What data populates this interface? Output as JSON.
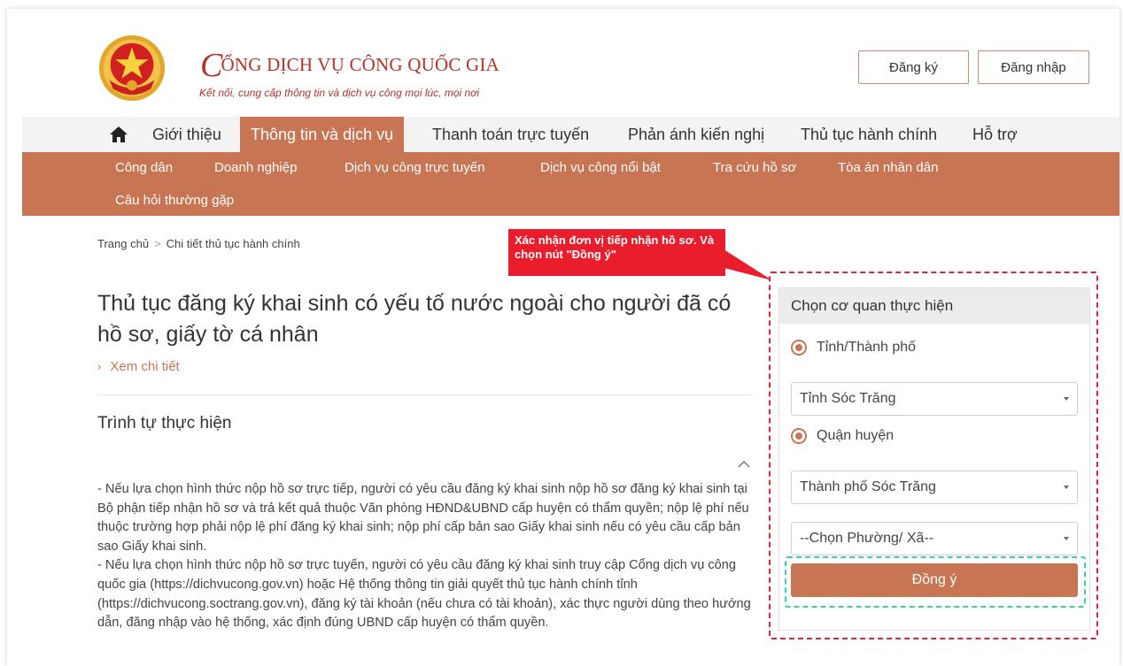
{
  "brand": {
    "title_initial": "C",
    "title_rest": "ỔNG DỊCH VỤ CÔNG QUỐC GIA",
    "subtitle": "Kết nối, cung cấp thông tin và dịch vụ công mọi lúc, mọi nơi"
  },
  "auth": {
    "register_label": "Đăng ký",
    "login_label": "Đăng nhập"
  },
  "main_nav": {
    "home_icon": "home-icon",
    "items": [
      {
        "label": "Giới thiệu"
      },
      {
        "label": "Thông tin và dịch vụ",
        "active": true
      },
      {
        "label": "Thanh toán trực tuyến"
      },
      {
        "label": "Phản ánh kiến nghị"
      },
      {
        "label": "Thủ tục hành chính"
      },
      {
        "label": "Hỗ trợ"
      }
    ]
  },
  "sub_nav": {
    "items": [
      {
        "label": "Công dân"
      },
      {
        "label": "Doanh nghiệp"
      },
      {
        "label": "Dịch vụ công trực tuyến"
      },
      {
        "label": "Dịch vụ công nổi bật"
      },
      {
        "label": "Tra cứu hồ sơ"
      },
      {
        "label": "Tòa án nhân dân"
      },
      {
        "label": "Câu hỏi thường gặp"
      }
    ]
  },
  "breadcrumb": {
    "home": "Trang chủ",
    "separator": ">",
    "current": "Chi tiết thủ tục hành chính"
  },
  "callout": {
    "text": "Xác nhận đơn vị tiếp nhận hồ sơ. Và chọn nút \"Đồng ý\"",
    "color": "#ea1d2c"
  },
  "content": {
    "title": "Thủ tục đăng ký khai sinh có yếu tố nước ngoài cho người đã có hồ sơ, giấy tờ cá nhân",
    "more_link": "Xem chi tiết",
    "section_title": "Trình tự thực hiện",
    "paragraphs": [
      "- Nếu lựa chọn hình thức nộp hồ sơ trực tiếp, người có yêu cầu đăng ký khai sinh nộp hồ sơ đăng ký khai sinh tại Bộ phận tiếp nhận hồ sơ và trả kết quả thuộc Văn phòng HĐND&UBND cấp huyện có thẩm quyền; nộp lệ phí nếu thuộc trường hợp phải nộp lệ phí đăng ký khai sinh; nộp phí cấp bản sao Giấy khai sinh nếu có yêu cầu cấp bản sao Giấy khai sinh.",
      "- Nếu lựa chọn hình thức nộp hồ sơ trực tuyến, người có yêu cầu đăng ký khai sinh truy cập Cổng dịch vụ công quốc gia (https://dichvucong.gov.vn) hoặc Hệ thống thông tin giải quyết thủ tục hành chính tỉnh (https://dichvucong.soctrang.gov.vn), đăng ký tài khoản (nếu chưa có tài khoản), xác thực người dùng theo hướng dẫn, đăng nhập vào hệ thống, xác định đúng UBND cấp huyện có thẩm quyền."
    ]
  },
  "panel": {
    "heading": "Chọn cơ quan thực hiện",
    "radio_province": "Tỉnh/Thành phố",
    "province_value": "Tỉnh Sóc Trăng",
    "radio_district": "Quận huyện",
    "district_value": "Thành phố Sóc Trăng",
    "ward_value": "--Chọn Phường/ Xã--",
    "submit_label": "Đồng ý"
  },
  "colors": {
    "brand": "#b2342a",
    "accent": "#c87553",
    "highlight_red": "#d9263a",
    "highlight_green": "#3fcf9a"
  }
}
